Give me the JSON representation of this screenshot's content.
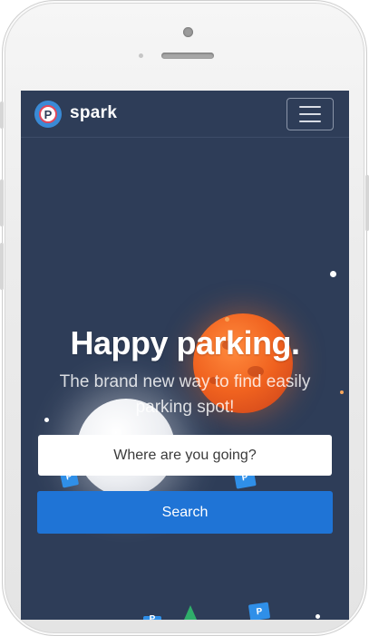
{
  "navbar": {
    "brand": "spark",
    "logo_letter": "P"
  },
  "hero": {
    "headline": "Happy parking.",
    "subline": "The brand new way to find easily parking spot!"
  },
  "search": {
    "placeholder": "Where are you going?",
    "button_label": "Search"
  },
  "signs": [
    "P",
    "P",
    "P",
    "P"
  ],
  "colors": {
    "screen_bg": "#2e3d58",
    "primary_button": "#1f74d6",
    "accent_planet": "#f0621f"
  },
  "icons": [
    "parking-logo-icon",
    "hamburger-menu-icon"
  ]
}
